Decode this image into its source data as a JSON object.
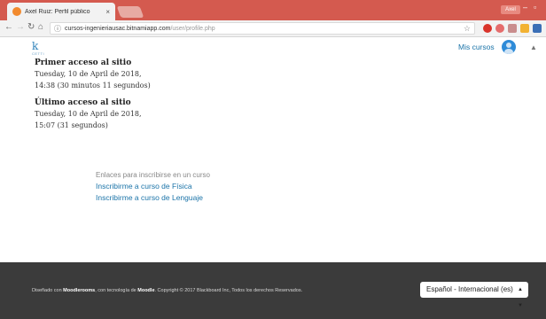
{
  "browser": {
    "tab_title": "Axel Ruiz: Perfil público",
    "tab_close": "×",
    "user_badge": "Axel",
    "url_host": "cursos-ingenieriausac.bitnamiapp.com",
    "url_path": "/user/profile.php"
  },
  "header": {
    "logo_text": "CETTI",
    "my_courses": "Mis cursos"
  },
  "access": {
    "first": {
      "title": "Primer acceso al sitio",
      "line1": "Tuesday, 10 de April de 2018,",
      "line2": "14:38  (30 minutos 11 segundos)"
    },
    "last": {
      "title": "Último acceso al sitio",
      "line1": "Tuesday, 10 de April de 2018,",
      "line2": "15:07  (31 segundos)"
    }
  },
  "enrol": {
    "heading": "Enlaces para inscribirse en un curso",
    "links": [
      "Inscribirme a curso de Física",
      "Inscribirme a curso de Lenguaje"
    ]
  },
  "footer": {
    "prefix": "Diseñado con ",
    "brand": "Moodlerooms",
    "middle": ", con tecnología de ",
    "moodle": "Moodle",
    "suffix": ". Copyright © 2017 Blackboard Inc, Todos los derechos Reservados.",
    "language": "Español - Internacional (es)"
  },
  "colors": {
    "titlebar": "#d45a4f",
    "link": "#1a73a8",
    "footer_bg": "#3b3b3b"
  }
}
